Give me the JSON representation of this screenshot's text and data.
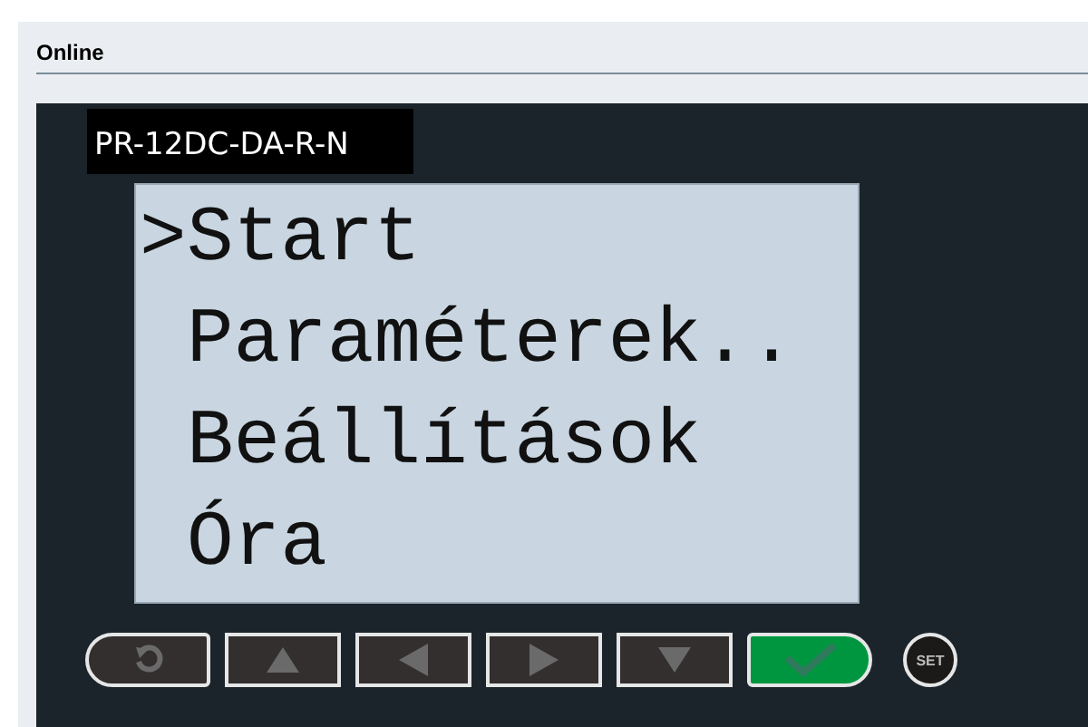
{
  "panel": {
    "title": "Online"
  },
  "device": {
    "model": "PR-12DC-DA-R-N"
  },
  "display": {
    "cursor": ">",
    "lines": [
      {
        "text": "Start",
        "selected": true
      },
      {
        "text": "Paraméterek..",
        "selected": false
      },
      {
        "text": "Beállítások",
        "selected": false
      },
      {
        "text": "Óra",
        "selected": false
      }
    ]
  },
  "keys": [
    {
      "kind": "back"
    },
    {
      "kind": "up"
    },
    {
      "kind": "left"
    },
    {
      "kind": "right"
    },
    {
      "kind": "down"
    },
    {
      "kind": "ok"
    },
    {
      "kind": "set",
      "label": "SET"
    }
  ]
}
